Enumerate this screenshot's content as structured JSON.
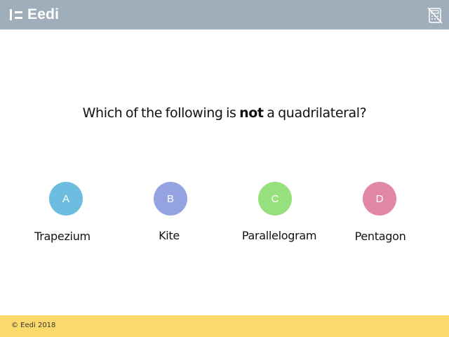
{
  "header": {
    "brand": "Eedi",
    "icon": "calculator-not-allowed-icon",
    "background": "#a0aebb"
  },
  "question": {
    "before": "Which of the following is ",
    "emphasis": "not",
    "after": " a quadrilateral?"
  },
  "options": [
    {
      "letter": "A",
      "text": "Trapezium",
      "color": "#6cbde0"
    },
    {
      "letter": "B",
      "text": "Kite",
      "color": "#95a2e2"
    },
    {
      "letter": "C",
      "text": "Parallelogram",
      "color": "#96e07d"
    },
    {
      "letter": "D",
      "text": "Pentagon",
      "color": "#e286a6"
    }
  ],
  "footer": {
    "copyright": "© Eedi 2018",
    "background": "#fcd96b"
  }
}
